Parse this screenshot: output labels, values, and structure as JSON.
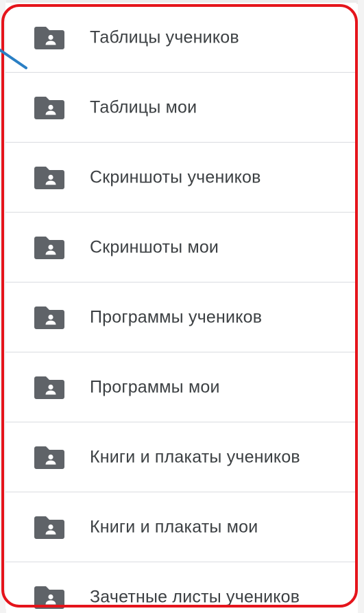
{
  "folders": [
    {
      "label": "Таблицы учеников",
      "icon": "shared-folder-icon"
    },
    {
      "label": "Таблицы мои",
      "icon": "shared-folder-icon"
    },
    {
      "label": "Скриншоты учеников",
      "icon": "shared-folder-icon"
    },
    {
      "label": "Скриншоты мои",
      "icon": "shared-folder-icon"
    },
    {
      "label": "Программы учеников",
      "icon": "shared-folder-icon"
    },
    {
      "label": "Программы мои",
      "icon": "shared-folder-icon"
    },
    {
      "label": "Книги и плакаты учеников",
      "icon": "shared-folder-icon"
    },
    {
      "label": "Книги и плакаты мои",
      "icon": "shared-folder-icon"
    },
    {
      "label": "Зачетные листы учеников",
      "icon": "shared-folder-icon"
    }
  ],
  "colors": {
    "highlight": "#e5141b",
    "icon": "#5f6368",
    "text": "#3c4043",
    "divider": "#dadce0",
    "pointer": "#2a7fc4"
  }
}
